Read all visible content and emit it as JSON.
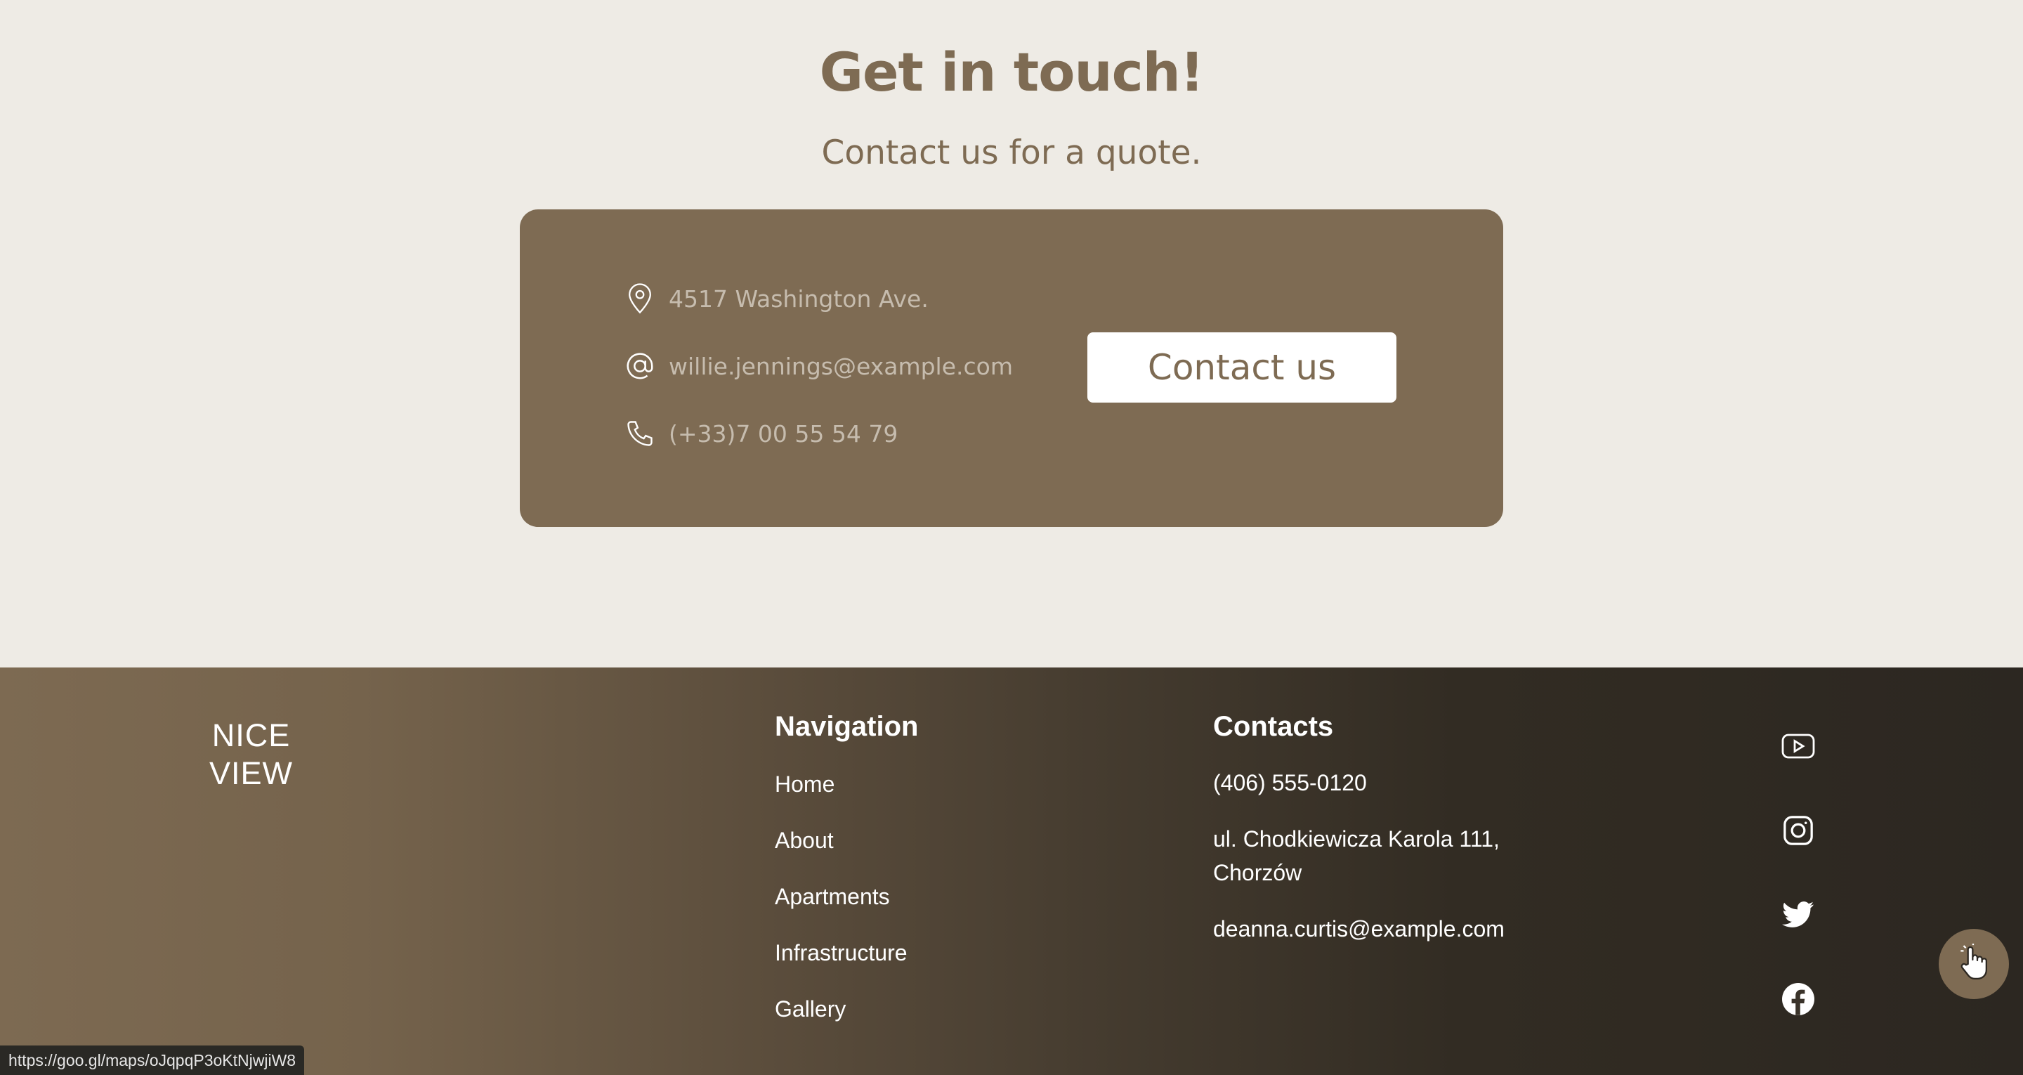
{
  "contact_section": {
    "title": "Get in touch!",
    "subtitle": "Contact us for a quote.",
    "address": "4517 Washington Ave.",
    "email": "willie.jennings@example.com",
    "phone": "(+33)7 00 55 54 79",
    "button_label": "Contact us"
  },
  "footer": {
    "logo_line1": "NICE",
    "logo_line2": "VIEW",
    "navigation": {
      "title": "Navigation",
      "links": [
        "Home",
        "About",
        "Apartments",
        "Infrastructure",
        "Gallery"
      ]
    },
    "contacts": {
      "title": "Contacts",
      "phone": "(406) 555-0120",
      "address_line1": "ul. Chodkiewicza Karola 111,",
      "address_line2": "Chorzów",
      "email": "deanna.curtis@example.com"
    },
    "social_icons": [
      "youtube-icon",
      "instagram-icon",
      "twitter-icon",
      "facebook-icon"
    ]
  },
  "status_bar": {
    "url": "https://goo.gl/maps/oJqpqP3oKtNjwjiW8"
  },
  "colors": {
    "accent": "#7e6b53",
    "background": "#eeebe5",
    "card_text": "#c6bcae"
  }
}
